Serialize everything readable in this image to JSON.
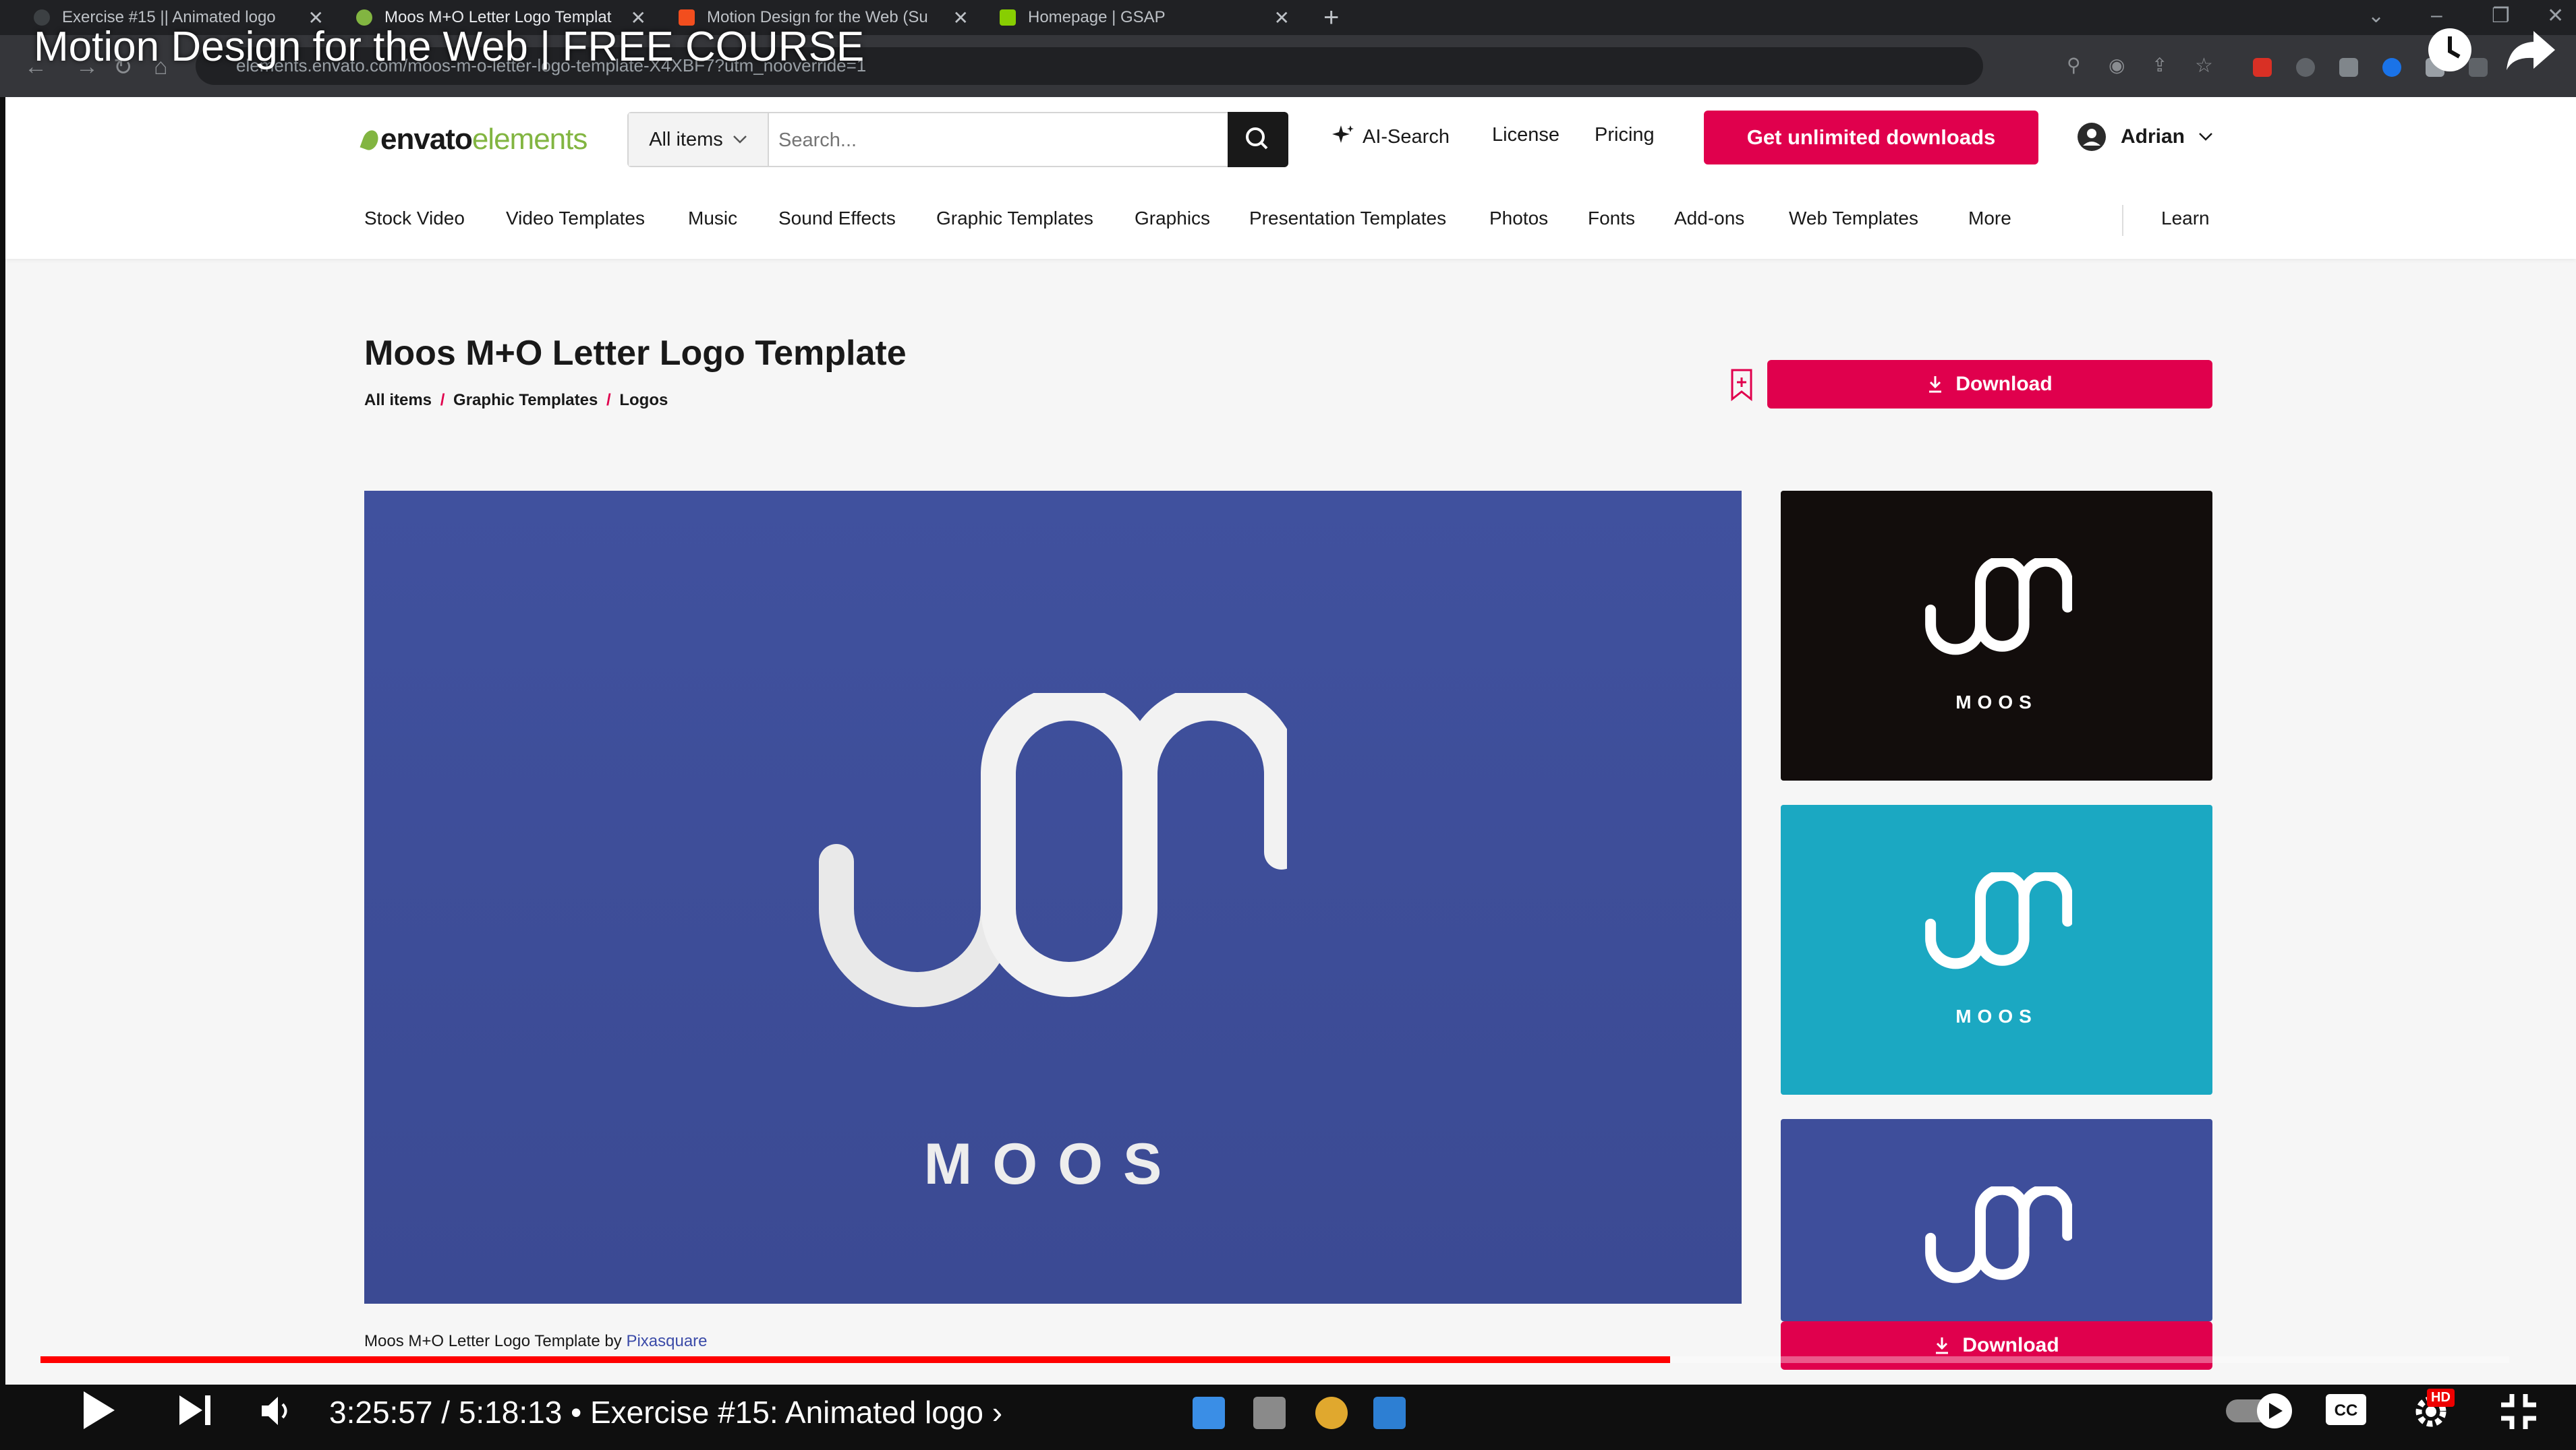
{
  "video": {
    "title": "Motion Design for the Web | FREE COURSE",
    "timestamp": "3:25:57 / 5:18:13",
    "chapter": "• Exercise #15: Animated logo ›",
    "progress_fraction": 0.66,
    "hd_badge": "HD"
  },
  "browser": {
    "tabs": [
      {
        "label": "Exercise #15 || Animated logo",
        "close": "✕"
      },
      {
        "label": "Moos M+O Letter Logo Templat",
        "close": "✕"
      },
      {
        "label": "Motion Design for the Web (Su",
        "close": "✕"
      },
      {
        "label": "Homepage | GSAP",
        "close": "✕"
      }
    ],
    "new_tab": "+",
    "url": "elements.envato.com/moos-m-o-letter-logo-template-X4XBF7?utm_nooverride=1"
  },
  "header": {
    "logo_main": "envato",
    "logo_sub": "elements",
    "filter_label": "All items",
    "search_placeholder": "Search...",
    "ai_search": "AI-Search",
    "license": "License",
    "pricing": "Pricing",
    "cta": "Get unlimited downloads",
    "user": "Adrian"
  },
  "categories": [
    "Stock Video",
    "Video Templates",
    "Music",
    "Sound Effects",
    "Graphic Templates",
    "Graphics",
    "Presentation Templates",
    "Photos",
    "Fonts",
    "Add-ons",
    "Web Templates",
    "More"
  ],
  "learn": "Learn",
  "item": {
    "title": "Moos M+O Letter Logo Template",
    "crumbs": [
      "All items",
      "Graphic Templates",
      "Logos"
    ],
    "crumb_sep": "/",
    "download": "Download",
    "wordmark": "MOOS",
    "thumb_wordmark": "MOOS",
    "credit_prefix": "Moos M+O Letter Logo Template by",
    "author": "Pixasquare"
  },
  "colors": {
    "accent": "#e0004d",
    "brand_green": "#82b541",
    "preview_blue": "#40519e",
    "thumb_black": "#120d0c",
    "thumb_teal": "#1ba8c2",
    "thumb_blue": "#3e4e9b"
  },
  "icons": [
    "search-icon",
    "sparkle-icon",
    "user-icon",
    "chevron-down-icon",
    "bookmark-icon",
    "download-icon",
    "play-icon",
    "next-icon",
    "volume-icon",
    "captions-icon",
    "settings-icon",
    "fullscreen-exit-icon",
    "clock-icon",
    "share-icon"
  ]
}
